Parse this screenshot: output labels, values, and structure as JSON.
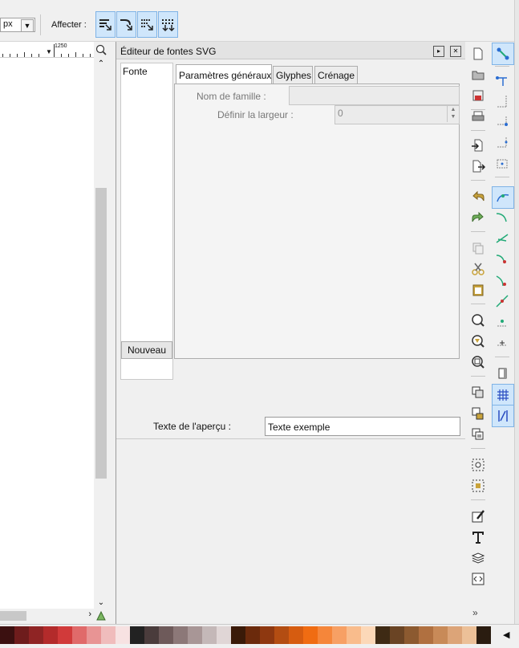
{
  "toolbar": {
    "unit": "px",
    "affect_label": "Affecter :",
    "affect_buttons": [
      "scale-stroke-icon",
      "scale-corners-icon",
      "move-gradients-icon",
      "move-patterns-icon"
    ]
  },
  "ruler": {
    "label": "1250"
  },
  "dialog": {
    "title": "Éditeur de fontes SVG",
    "font_list_header": "Fonte",
    "new_button": "Nouveau",
    "tabs": [
      "Paramètres généraux",
      "Glyphes",
      "Crénage"
    ],
    "family_name_label": "Nom de famille :",
    "family_name_value": "",
    "set_width_label": "Définir la largeur :",
    "set_width_value": "0",
    "preview_label": "Texte de l'aperçu :",
    "preview_value": "Texte exemple"
  },
  "commands_bar": {
    "items": [
      "new-document-icon",
      "open-icon",
      "save-icon",
      "print-icon",
      "import-icon",
      "export-icon",
      "undo-icon",
      "redo-icon",
      "duplicate-icon",
      "cut-icon",
      "paste-icon",
      "zoom-selection-icon",
      "zoom-drawing-icon",
      "zoom-page-icon",
      "clone-icon",
      "lock-icon",
      "unlock-icon",
      "group-icon",
      "ungroup-icon",
      "fill-stroke-icon",
      "text-font-icon",
      "layers-icon",
      "xml-editor-icon"
    ],
    "more": "»"
  },
  "snap_bar": {
    "items": [
      "snap-toggle-icon",
      "snap-bbox-icon",
      "snap-bbox-edge-icon",
      "snap-bbox-corner-icon",
      "snap-bbox-midpoint-icon",
      "snap-bbox-center-icon",
      "snap-nodes-icon",
      "snap-path-icon",
      "snap-intersection-icon",
      "snap-cusp-icon",
      "snap-smooth-icon",
      "snap-midpoint-icon",
      "snap-center-icon",
      "snap-rotation-icon",
      "snap-page-icon",
      "snap-grid-icon",
      "snap-guide-icon"
    ],
    "active": [
      "snap-toggle-icon",
      "snap-nodes-icon",
      "snap-grid-icon",
      "snap-guide-icon"
    ]
  },
  "palette": {
    "colors": [
      "#3b1010",
      "#6e1c1c",
      "#8f2424",
      "#b32b2b",
      "#d13a3a",
      "#e06a6a",
      "#e89494",
      "#f0bcbc",
      "#f7e2e2",
      "#222222",
      "#4a3c3c",
      "#6e5a5a",
      "#8c7878",
      "#a89696",
      "#c4b8b8",
      "#e0d6d6",
      "#3a1a08",
      "#6b2a0c",
      "#8e3810",
      "#b34d12",
      "#d65c10",
      "#f06c12",
      "#f5863a",
      "#f7a064",
      "#f9bc8c",
      "#fcd8b8",
      "#3e2a14",
      "#6a4424",
      "#8c5a30",
      "#b07040",
      "#c88a58",
      "#dca478",
      "#ecc098",
      "#2a1c10"
    ]
  }
}
